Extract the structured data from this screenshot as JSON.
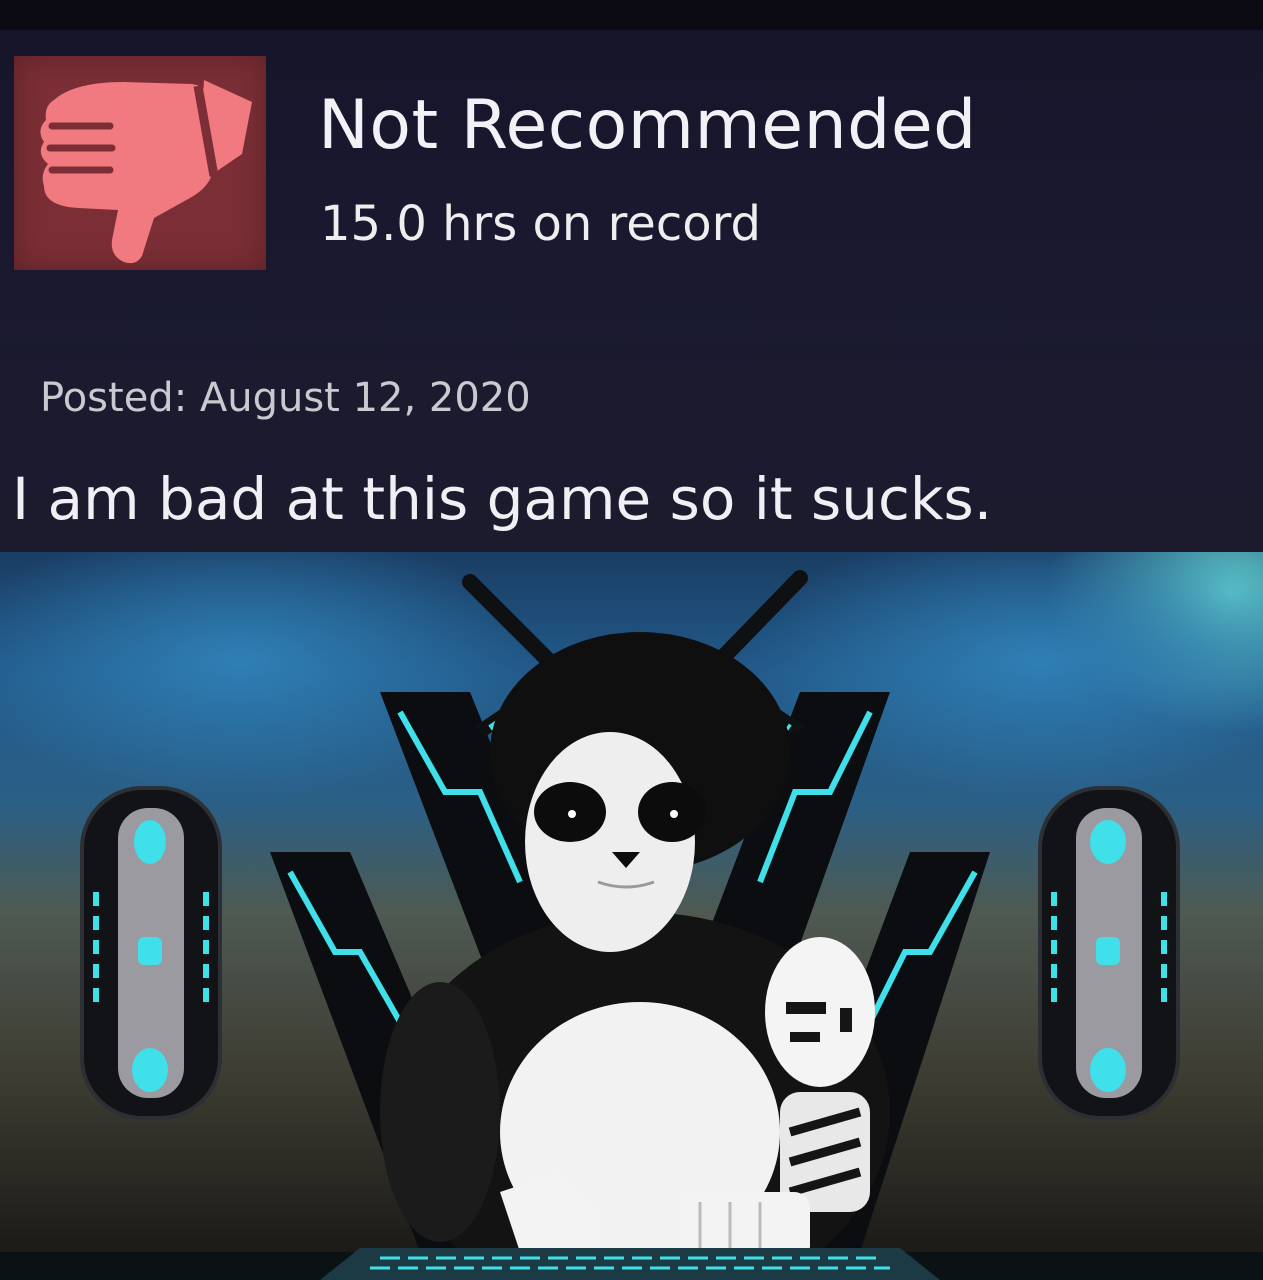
{
  "review": {
    "verdict": "Not Recommended",
    "hours": "15.0 hrs on record",
    "posted": "Posted: August 12, 2020",
    "text": "I am bad at this game so it sucks.",
    "icon": "thumbs-down-icon",
    "colors": {
      "panel": "#1c1b2e",
      "icon_box": "#7b2e35",
      "icon": "#f07a7f",
      "text": "#f0f0f4"
    }
  },
  "image": {
    "subject": "panda-character-illustration",
    "accent": "#3fd6e6"
  }
}
